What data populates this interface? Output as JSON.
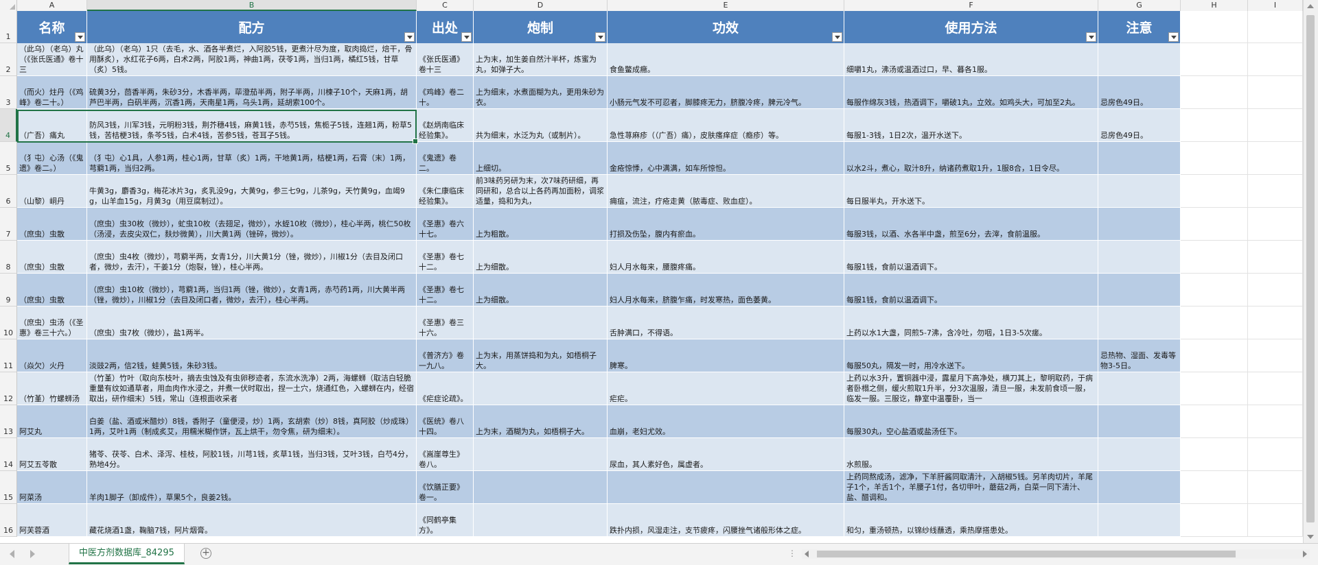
{
  "columns": [
    "A",
    "B",
    "C",
    "D",
    "E",
    "F",
    "G",
    "H",
    "I"
  ],
  "selected_column": "B",
  "headers": [
    "名称",
    "配方",
    "出处",
    "炮制",
    "功效",
    "使用方法",
    "注意"
  ],
  "row_numbers": [
    "1",
    "2",
    "3",
    "4",
    "5",
    "6",
    "7",
    "8",
    "9",
    "10",
    "11",
    "12",
    "13",
    "14",
    "15",
    "16"
  ],
  "selected_row": "4",
  "rows": [
    [
      "（此乌）（老乌）丸（《张氏医通》卷十三",
      "（此乌）（老乌）1只（去毛，水、酒各半煮烂，入阿胶5钱，更煮汁尽为度，取肉捣烂，焙干，骨用酥炙），水红花子6两，白术2两，阿胶1两，神曲1两，茯苓1两，当归1两，橘红5钱，甘草（炙）5钱。",
      "《张氏医通》卷十三",
      "上为末，加生姜自然汁半杯，炼蜜为丸，如弹子大。",
      "食鱼鳖成癥。",
      "细嚼1丸，沸汤或温酒过口，早、暮各1服。",
      ""
    ],
    [
      "（而火）炷丹（《鸡峰》卷二十。）",
      "硫黄3分，茴香半两，朱砂3分，木香半两，荜澄茄半两，附子半两，川楝子10个，天麻1两，胡芦巴半两，白矾半两，沉香1两，天南星1两，乌头1两，延胡索100个。",
      "《鸡峰》卷二十。",
      "上为细末，水煮面糊为丸，更用朱砂为衣。",
      "小肠元气发不可忍者，脚膝疼无力，脐腹冷疼，脾元冷气。",
      "每服作绵灰3钱，热酒调下，嚼破1丸，立效。如鸡头大，可加至2丸。",
      "忌房色49日。"
    ],
    [
      "（广吾）痛丸",
      "防风3钱，川军3钱，元明粉3钱，荆芥穗4钱，麻黄1钱，赤芍5钱，焦栀子5钱，连翘1两，粉草5钱，苦桔梗3钱，条芩5钱，白术4钱，苦参5钱，苍耳子5钱。",
      "《赵炳南临床经验集》。",
      "共为细末，水泛为丸（或制片）。",
      "急性荨麻疹（（广吾）痛），皮肤瘙痒症（瘾疹）等。",
      "每服1-3钱，1日2次，温开水送下。",
      "忌房色49日。"
    ],
    [
      "（犭屯）心汤（《鬼遗》卷二。）",
      "（犭屯）心1具，人参1两，桂心1两，甘草（炙）1两，干地黄1两，桔梗1两，石膏（末）1两，芎藭1两，当归2两。",
      "《鬼遗》卷二。",
      "上细切。",
      "金疮惊悸，心中满满，如车所惊怛。",
      "以水2斗，煮心，取汁8升，纳诸药煮取1升，1服8合，1日令尽。",
      ""
    ],
    [
      "（山黎）峒丹",
      "牛黄3g，麝香3g，梅花冰片3g，炙乳没9g，大黄9g，参三七9g，儿茶9g，天竹黄9g，血竭9g，山羊血15g，月黄3g（用豆腐制过）。",
      "《朱仁康临床经验集》。",
      "前3味药另研为末，次7味药研细，再同研和，总合以上各药再加面粉，调浆适量，捣和为丸，",
      "痈疽，流注，疔疮走黄（脓毒症、败血症）。",
      "每日服半丸，开水送下。",
      ""
    ],
    [
      "（庶虫）虫散",
      "（庶虫）虫30枚（微炒），虻虫10枚（去翅足，微炒），水蛭10枚（微炒），桂心半两，桃仁50枚（汤浸，去皮尖双仁，麸炒微黄），川大黄1两（锉碎，微炒）。",
      "《圣惠》卷六十七。",
      "上为粗散。",
      "打损及伤坠，腹内有瘀血。",
      "每服3钱，以酒、水各半中盏，煎至6分，去滓，食前温服。",
      ""
    ],
    [
      "（庶虫）虫散",
      "（庶虫）虫4枚（微炒），芎藭半两，女青1分，川大黄1分（锉，微炒），川椒1分（去目及闭口者，微炒，去汗），干姜1分（炮裂，锉），桂心半两。",
      "《圣惠》卷七十二。",
      "上为细散。",
      "妇人月水每来，腰腹疼痛。",
      "每服1钱，食前以温酒调下。",
      ""
    ],
    [
      "（庶虫）虫散",
      "（庶虫）虫10枚（微炒），芎藭1两，当归1两（锉，微炒），女青1两，赤芍药1两，川大黄半两（锉，微炒），川椒1分（去目及闭口者，微炒，去汗），桂心半两。",
      "《圣惠》卷七十二。",
      "上为细散。",
      "妇人月水每来，脐腹乍痛，时发寒热，面色萎黄。",
      "每服1钱，食前以温酒调下。",
      ""
    ],
    [
      "（庶虫）虫汤（《圣惠》卷三十六。）",
      "（庶虫）虫7枚（微炒），盐1两半。",
      "《圣惠》卷三十六。",
      "",
      "舌肿满口，不得语。",
      "上药以水1大盏，同煎5-7沸，含冷吐，勿咽，1日3-5次瘥。",
      ""
    ],
    [
      "（焱欠）火丹",
      "淡豉2两，信2钱，蛙黄5钱，朱砂3钱。",
      "《普济方》卷一九八。",
      "上为末，用蒸饼捣和为丸，如梧桐子大。",
      "脾寒。",
      "每服50丸，隔发一时，用冷水送下。",
      "忌热物、湿面、发毒等物3-5日。"
    ],
    [
      "（竹堇）竹螺蛳汤",
      "（竹堇）竹叶（取向东枝叶，摘去虫蚀及有虫卵秽迹者，东流水洗净）2两，海螺蛳（取洁白轻脆重量有纹如通草者，用血肉作水浸之，并煮一伏时取出，捏一土穴，烧通红色，入螺蛳在内，经宿取出，研作细末）5钱，常山（连根面收采者",
      "《疟症论疏》。",
      "",
      "疟疟。",
      "上药以水3升，置铜器中浸，露星月下高净处，横刀其上，黎明取药，于病者卧榻之侧，缓火煎取1升半，分3次温服，清旦一服，未发前食顷一服，临发一服。三服讫，静室中温覆卧，当一",
      ""
    ],
    [
      "阿艾丸",
      "白姜（盐、酒或米醋炒）8钱，香附子（童便浸，炒）1两，玄胡索（炒）8钱，真阿胶（炒成珠）1两，艾叶1两（制成炙艾，用糯米糊作饼，瓦上烘干，勿令焦，研为细末）。",
      "《医统》卷八十四。",
      "上为末，酒糊为丸，如梧桐子大。",
      "血崩，老妇尤效。",
      "每服30丸，空心盐酒或盐汤任下。",
      ""
    ],
    [
      "阿艾五苓散",
      "猪苓、茯苓、白术、泽泻、桂枝，阿胶1钱，川芎1钱，炙草1钱，当归3钱，艾叶3钱，白芍4分，熟地4分。",
      "《嵩崖尊生》卷八。",
      "",
      "尿血，其人素好色，属虚者。",
      "水煎服。",
      ""
    ],
    [
      "阿菜汤",
      "羊肉1脚子（卸成件），草果5个，良姜2钱。",
      "《饮膳正要》卷一。",
      "",
      "",
      "上药同熬成汤，滤净，下羊肝酱同取清汁，入胡椒5钱。另羊肉切片，羊尾子1个，羊舌1个，羊腰子1付，各切甲叶，蘑菇2两，白菜一同下清汁、盐、醋调和。",
      ""
    ],
    [
      "阿芙蓉酒",
      "藏花烧酒1盏，鞠脑7钱，阿片烟膏。",
      "《同鹤亭集方》。",
      "",
      "跌扑内损，风湿走注，支节疲疼，闪腰挫气诸般形体之症。",
      "和匀，重汤顿热，以锦纱线蘸透，乘热摩搭患处。",
      ""
    ]
  ],
  "sheet_tab": "中医方剂数据库_84295",
  "colors": {
    "header_fill": "#4f81bd",
    "band_light": "#dce6f1",
    "band_dark": "#b8cce4",
    "excel_green": "#217346"
  }
}
